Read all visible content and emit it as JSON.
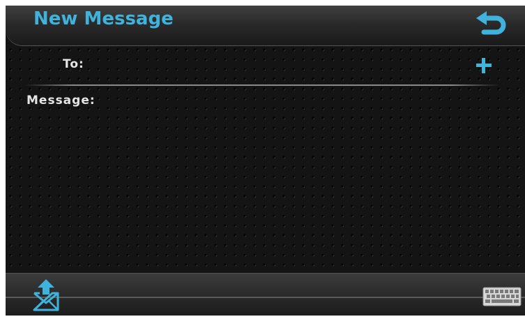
{
  "header": {
    "title": "New Message"
  },
  "form": {
    "to_label": "To:",
    "message_label": "Message:"
  },
  "icons": {
    "back": "back-arrow-icon",
    "add": "plus-icon",
    "send": "send-mail-icon",
    "keyboard": "keyboard-icon"
  },
  "colors": {
    "accent": "#3fb3dc",
    "background": "#141414",
    "label": "#e6e6e6"
  }
}
